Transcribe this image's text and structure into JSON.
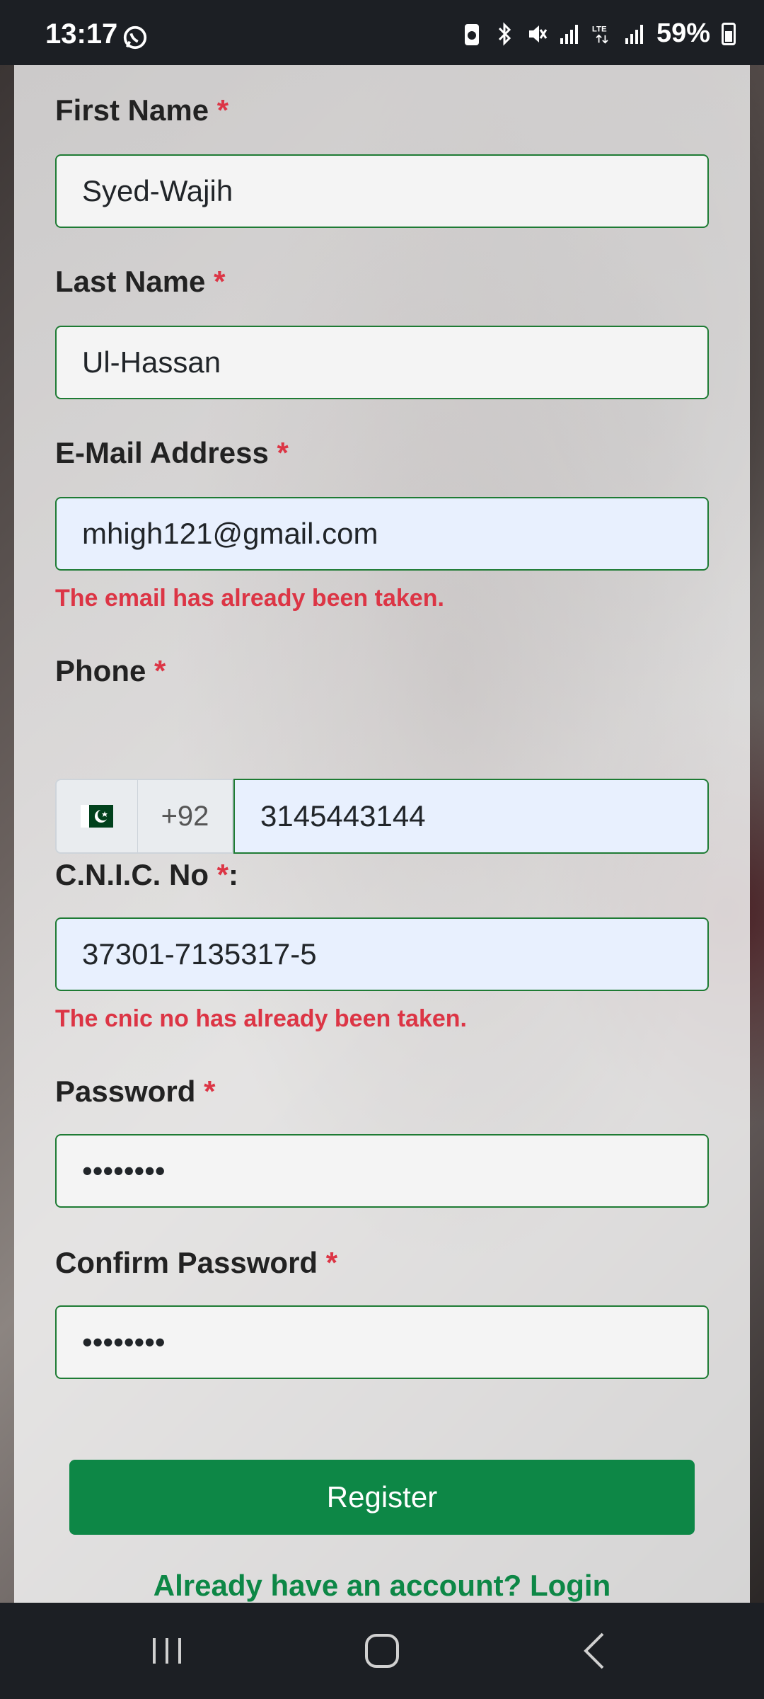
{
  "status_bar": {
    "time": "13:17",
    "battery": "59%",
    "icons": [
      "whatsapp-icon",
      "battery-saver-icon",
      "bluetooth-icon",
      "mute-icon",
      "signal-icon",
      "lte-icon",
      "signal-icon"
    ]
  },
  "form": {
    "first_name": {
      "label": "First Name",
      "required": "*",
      "value": "Syed-Wajih"
    },
    "last_name": {
      "label": "Last Name",
      "required": "*",
      "value": "Ul-Hassan"
    },
    "email": {
      "label": "E-Mail Address",
      "required": "*",
      "value": "mhigh121@gmail.com",
      "error": "The email has already been taken."
    },
    "phone": {
      "label": "Phone",
      "required": "*",
      "country_code": "+92",
      "value": "3145443144",
      "flag": "pakistan-flag-icon"
    },
    "cnic": {
      "label": "C.N.I.C. No",
      "required": "*",
      "suffix": ":",
      "value": "37301-7135317-5",
      "error": "The cnic no has already been taken."
    },
    "password": {
      "label": "Password",
      "required": "*",
      "value": "••••••••"
    },
    "confirm_password": {
      "label": "Confirm Password",
      "required": "*",
      "value": "••••••••"
    },
    "register_label": "Register",
    "login_link": "Already have an account? Login"
  },
  "colors": {
    "accent": "#0d8746",
    "error": "#dc3545",
    "border": "#1e7b34"
  }
}
